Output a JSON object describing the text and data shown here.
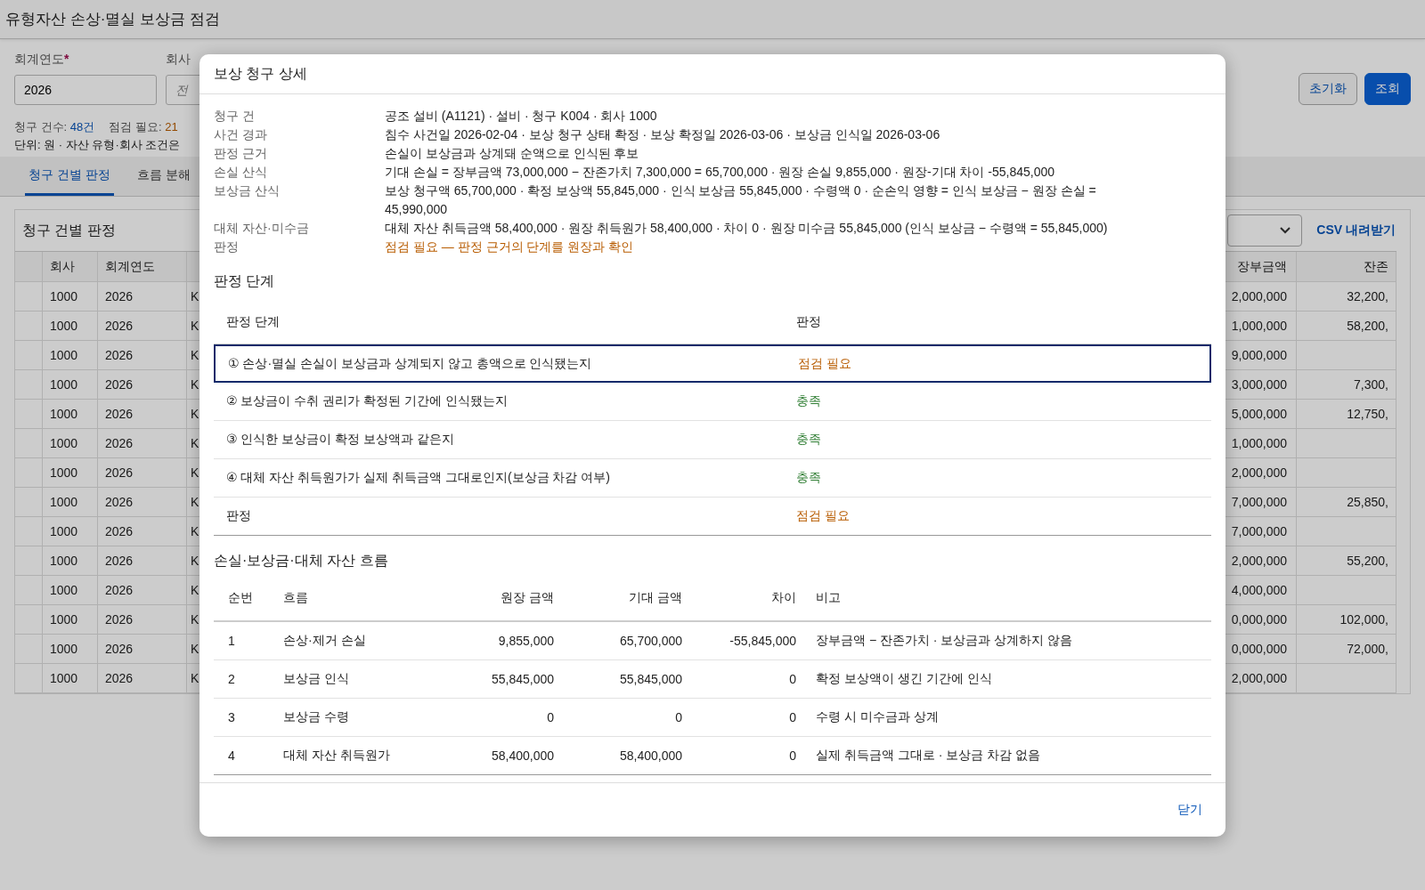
{
  "page_title": "유형자산 손상·멸실 보상금 점검",
  "filters": [
    {
      "label": "회계연도",
      "required_mark": "*",
      "value": "2026"
    },
    {
      "label": "회사",
      "placeholder": "전"
    }
  ],
  "buttons": [
    {
      "label": "초기화",
      "kind": "secondary"
    },
    {
      "label": "조회",
      "kind": "primary"
    }
  ],
  "summary": [
    {
      "label": "청구 건수: ",
      "value": "48건"
    },
    {
      "label": "점검 필요: ",
      "value": "21"
    }
  ],
  "unit_note": "단위: 원 · 자산 유형·회사 조건은",
  "tabs": [
    {
      "label": "청구 건별 판정",
      "selected": true
    },
    {
      "label": "흐름 분해",
      "selected": false
    }
  ],
  "panel": {
    "title": "청구 건별 판정",
    "csv_link": "CSV 내려받기",
    "columns": [
      "회사",
      "회계연도",
      "장부금액",
      "잔존"
    ],
    "rows": [
      {
        "company": "1000",
        "year": "2026",
        "column_3": "K",
        "book": "2,000,000",
        "residual": "32,200,"
      },
      {
        "company": "1000",
        "year": "2026",
        "column_3": "K",
        "book": "1,000,000",
        "residual": "58,200,"
      },
      {
        "company": "1000",
        "year": "2026",
        "column_3": "K",
        "book": "9,000,000"
      },
      {
        "company": "1000",
        "year": "2026",
        "column_3": "K",
        "book": "3,000,000",
        "residual": "7,300,"
      },
      {
        "company": "1000",
        "year": "2026",
        "column_3": "K",
        "book": "5,000,000",
        "residual": "12,750,"
      },
      {
        "company": "1000",
        "year": "2026",
        "column_3": "K",
        "book": "1,000,000"
      },
      {
        "company": "1000",
        "year": "2026",
        "column_3": "K",
        "book": "2,000,000"
      },
      {
        "company": "1000",
        "year": "2026",
        "column_3": "K",
        "book": "7,000,000",
        "residual": "25,850,"
      },
      {
        "company": "1000",
        "year": "2026",
        "column_3": "K",
        "book": "7,000,000"
      },
      {
        "company": "1000",
        "year": "2026",
        "column_3": "K",
        "book": "2,000,000",
        "residual": "55,200,"
      },
      {
        "company": "1000",
        "year": "2026",
        "column_3": "K",
        "book": "4,000,000"
      },
      {
        "company": "1000",
        "year": "2026",
        "column_3": "K",
        "book": "0,000,000",
        "residual": "102,000,"
      },
      {
        "company": "1000",
        "year": "2026",
        "column_3": "K",
        "book": "0,000,000",
        "residual": "72,000,"
      },
      {
        "company": "1000",
        "year": "2026",
        "column_3": "K",
        "book": "2,000,000"
      }
    ]
  },
  "modal": {
    "title": "보상 청구 상세",
    "details": [
      {
        "label": "청구 건",
        "value": "공조 설비 (A1121) · 설비 · 청구 K004 · 회사 1000",
        "color": "#222222"
      },
      {
        "label": "사건 경과",
        "value": "침수 사건일 2026-02-04 · 보상 청구 상태 확정 · 보상 확정일 2026-03-06 · 보상금 인식일 2026-03-06",
        "color": "#222222"
      },
      {
        "label": "판정 근거",
        "value": "손실이 보상금과 상계돼 순액으로 인식된 후보",
        "color": "#222222"
      },
      {
        "label": "손실 산식",
        "value": "기대 손실 = 장부금액 73,000,000 − 잔존가치 7,300,000 = 65,700,000 · 원장 손실 9,855,000 · 원장-기대 차이 -55,845,000",
        "color": "#222222"
      },
      {
        "label": "보상금 산식",
        "value": "보상 청구액 65,700,000 · 확정 보상액 55,845,000 · 인식 보상금 55,845,000 · 수령액 0 · 순손익 영향 = 인식 보상금 − 원장 손실 = 45,990,000",
        "color": "#222222"
      },
      {
        "label": "대체 자산·미수금",
        "value": "대체 자산 취득금액 58,400,000 · 원장 취득원가 58,400,000 · 차이 0 · 원장 미수금 55,845,000 (인식 보상금 − 수령액 = 55,845,000)",
        "color": "#222222"
      },
      {
        "label": "판정",
        "value": "점검 필요 — 판정 근거의 단계를 원장과 확인",
        "color": "#b85c00"
      }
    ],
    "steps": {
      "title": "판정 단계",
      "columns": [
        "판정 단계",
        "판정"
      ],
      "rows": [
        {
          "step": "① 손상·멸실 손실이 보상금과 상계되지 않고 총액으로 인식됐는지",
          "result": "점검 필요",
          "color": "#b85c00",
          "selected": true
        },
        {
          "step": "② 보상금이 수취 권리가 확정된 기간에 인식됐는지",
          "result": "충족",
          "color": "#2e7d32",
          "selected": false
        },
        {
          "step": "③ 인식한 보상금이 확정 보상액과 같은지",
          "result": "충족",
          "color": "#2e7d32",
          "selected": false
        },
        {
          "step": "④ 대체 자산 취득원가가 실제 취득금액 그대로인지(보상금 차감 여부)",
          "result": "충족",
          "color": "#2e7d32",
          "selected": false
        },
        {
          "step": "판정",
          "result": "점검 필요",
          "color": "#b85c00",
          "selected": false
        }
      ]
    },
    "flow": {
      "title": "손실·보상금·대체 자산 흐름",
      "columns": [
        "순번",
        "흐름",
        "원장 금액",
        "기대 금액",
        "차이",
        "비고"
      ],
      "rows": [
        [
          "1",
          "손상·제거 손실",
          "9,855,000",
          "65,700,000",
          "-55,845,000",
          "장부금액 − 잔존가치 · 보상금과 상계하지 않음"
        ],
        [
          "2",
          "보상금 인식",
          "55,845,000",
          "55,845,000",
          "0",
          "확정 보상액이 생긴 기간에 인식"
        ],
        [
          "3",
          "보상금 수령",
          "0",
          "0",
          "0",
          "수령 시 미수금과 상계"
        ],
        [
          "4",
          "대체 자산 취득원가",
          "58,400,000",
          "58,400,000",
          "0",
          "실제 취득금액 그대로 · 보상금 차감 없음"
        ]
      ]
    },
    "close": "닫기"
  }
}
